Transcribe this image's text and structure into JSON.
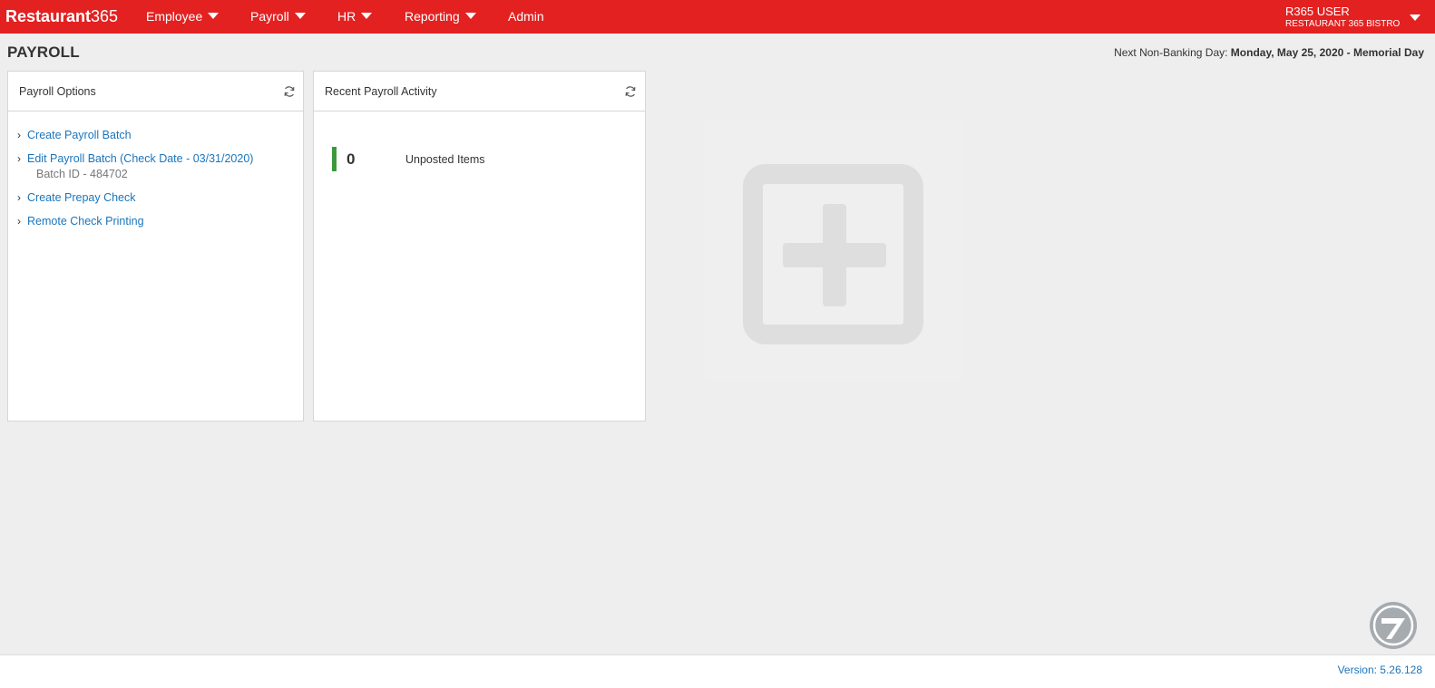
{
  "header": {
    "brand_main": "Restaurant",
    "brand_num": "365",
    "nav": [
      {
        "label": "Employee"
      },
      {
        "label": "Payroll"
      },
      {
        "label": "HR"
      },
      {
        "label": "Reporting"
      },
      {
        "label": "Admin"
      }
    ],
    "user": {
      "name": "R365 USER",
      "org": "RESTAURANT 365 BISTRO"
    }
  },
  "page": {
    "title": "PAYROLL",
    "non_banking_label": "Next Non-Banking Day:",
    "non_banking_value": "Monday, May 25, 2020 - Memorial Day"
  },
  "payroll_options": {
    "title": "Payroll Options",
    "items": [
      {
        "label": "Create Payroll Batch"
      },
      {
        "label": "Edit Payroll Batch (Check Date - 03/31/2020)",
        "sub": "Batch ID - 484702"
      },
      {
        "label": "Create Prepay Check"
      },
      {
        "label": "Remote Check Printing"
      }
    ]
  },
  "recent_activity": {
    "title": "Recent Payroll Activity",
    "count": "0",
    "label": "Unposted Items"
  },
  "footer": {
    "version": "Version: 5.26.128"
  },
  "colors": {
    "brand_red": "#e32121",
    "link_blue": "#1b75bb",
    "status_green": "#3a9a3a"
  },
  "icons": {
    "refresh": "refresh-icon",
    "add_widget": "plus-square-icon",
    "help": "help-logo-icon"
  }
}
